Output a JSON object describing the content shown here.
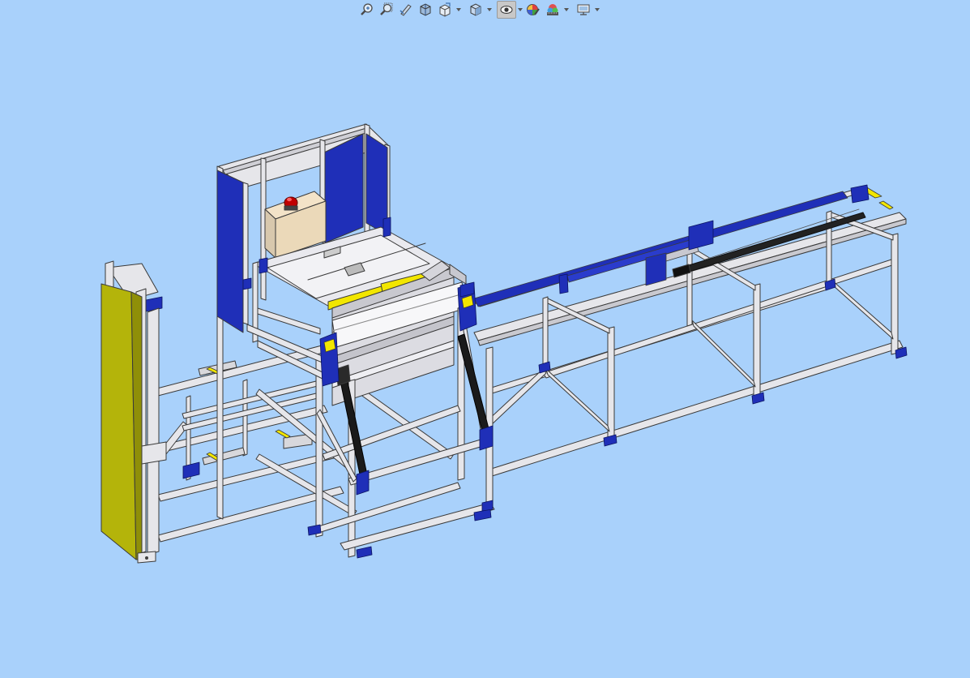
{
  "app": {
    "background_color": "#a9d1fb"
  },
  "toolbar": {
    "items": [
      {
        "name": "zoom-to-fit-icon",
        "active": false,
        "has_menu": false
      },
      {
        "name": "zoom-to-area-icon",
        "active": false,
        "has_menu": false
      },
      {
        "name": "previous-view-icon",
        "active": false,
        "has_menu": false
      },
      {
        "name": "section-view-icon",
        "active": false,
        "has_menu": false
      },
      {
        "name": "view-orientation-icon",
        "active": false,
        "has_menu": true
      },
      {
        "name": "display-style-icon",
        "active": false,
        "has_menu": true
      },
      {
        "name": "hide-show-items-icon",
        "active": true,
        "has_menu": true
      },
      {
        "name": "edit-appearance-icon",
        "active": false,
        "has_menu": false
      },
      {
        "name": "apply-scene-icon",
        "active": false,
        "has_menu": true
      },
      {
        "name": "view-settings-icon",
        "active": false,
        "has_menu": true
      }
    ]
  },
  "model": {
    "frame_color": "#e6e6ea",
    "frame_edge_color": "#3a3a3a",
    "accent_blue": "#1f2fb8",
    "accent_yellow": "#f2e600",
    "door_color": "#b4b40a",
    "beacon_color": "#c00000"
  }
}
